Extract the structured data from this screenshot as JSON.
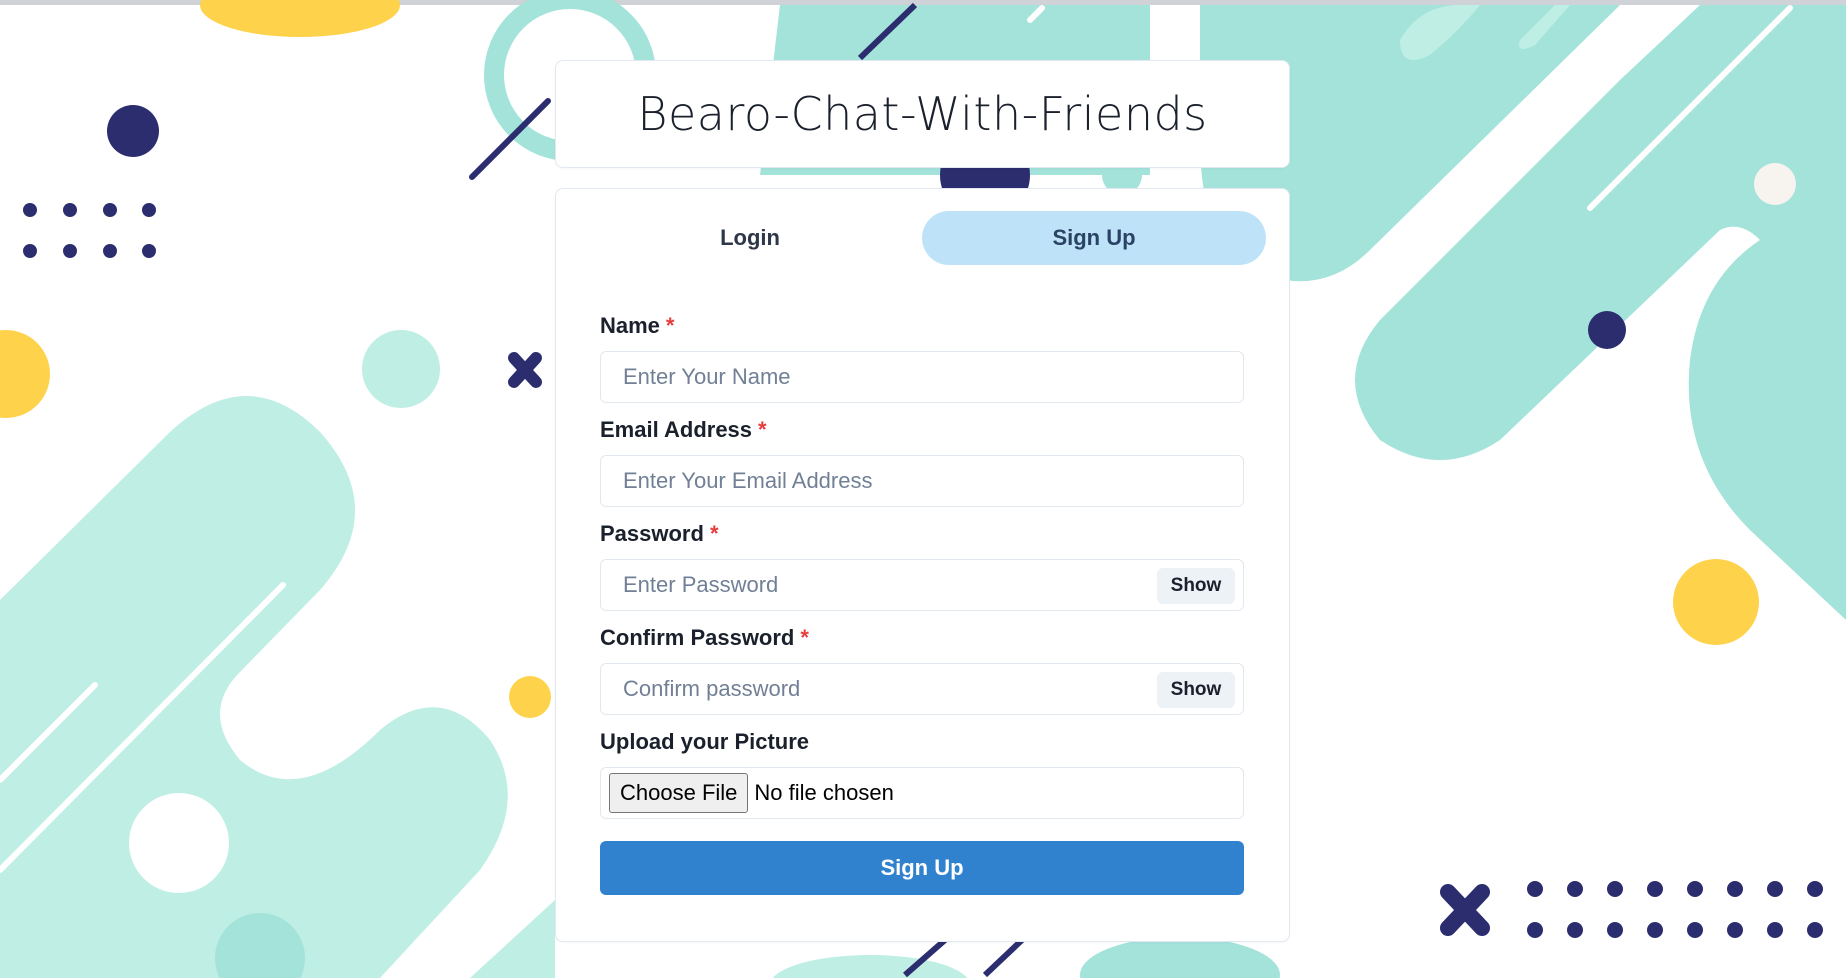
{
  "app": {
    "title": "Bearo-Chat-With-Friends"
  },
  "tabs": [
    {
      "label": "Login",
      "active": false
    },
    {
      "label": "Sign Up",
      "active": true
    }
  ],
  "form": {
    "name": {
      "label": "Name",
      "required_mark": "*",
      "placeholder": "Enter Your Name",
      "value": ""
    },
    "email": {
      "label": "Email Address",
      "required_mark": "*",
      "placeholder": "Enter Your Email Address",
      "value": ""
    },
    "password": {
      "label": "Password",
      "required_mark": "*",
      "placeholder": "Enter Password",
      "value": "",
      "toggle_label": "Show"
    },
    "confirm_password": {
      "label": "Confirm Password",
      "required_mark": "*",
      "placeholder": "Confirm password",
      "value": "",
      "toggle_label": "Show"
    },
    "picture": {
      "label": "Upload your Picture",
      "button_label": "Choose File",
      "status": "No file chosen"
    },
    "submit_label": "Sign Up"
  },
  "colors": {
    "accent": "#3182ce",
    "active_tab_bg": "#bee3f8",
    "mint": "#a3e3da",
    "navy": "#2b2d6e",
    "yellow": "#ffd24c",
    "required": "#e53e3e"
  }
}
